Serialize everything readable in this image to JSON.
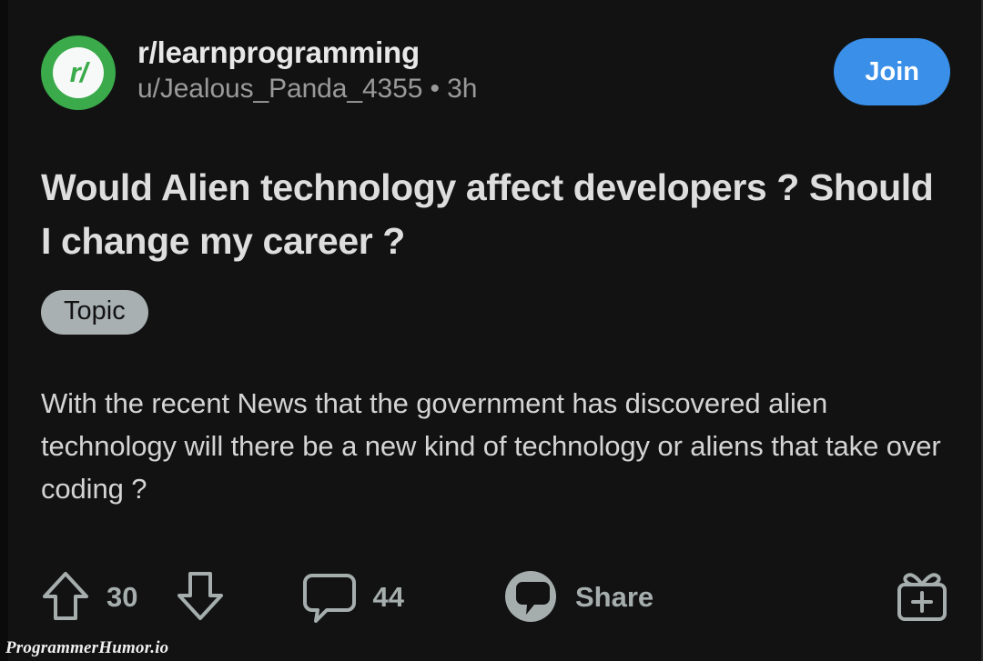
{
  "theme": {
    "background": "#121212",
    "accent_blue": "#3a8fe8",
    "avatar_green": "#3aaa4a",
    "flair_gray": "#a9b0b2",
    "text_primary": "#dedede",
    "text_secondary": "#9a9a9a",
    "icon_gray": "#a6adad"
  },
  "header": {
    "avatar_label": "r/",
    "avatar_icon": "reddit-snoo-icon",
    "subreddit": "r/learnprogramming",
    "meta": "u/Jealous_Panda_4355 • 3h",
    "author": "u/Jealous_Panda_4355",
    "timestamp": "3h",
    "join_label": "Join"
  },
  "post": {
    "title": "Would Alien technology affect developers ? Should I change my career ?",
    "flair": "Topic",
    "body": "With the recent News that the government has discovered alien technology will there be a new kind of technology or aliens that take over coding ?"
  },
  "actions": {
    "upvote_icon": "upvote-arrow-icon",
    "upvote_count": "30",
    "downvote_icon": "downvote-arrow-icon",
    "comment_icon": "comment-bubble-icon",
    "comment_count": "44",
    "share_icon": "share-icon",
    "share_label": "Share",
    "award_icon": "gift-award-icon"
  },
  "watermark": {
    "text": "ProgrammerHumor.io"
  }
}
